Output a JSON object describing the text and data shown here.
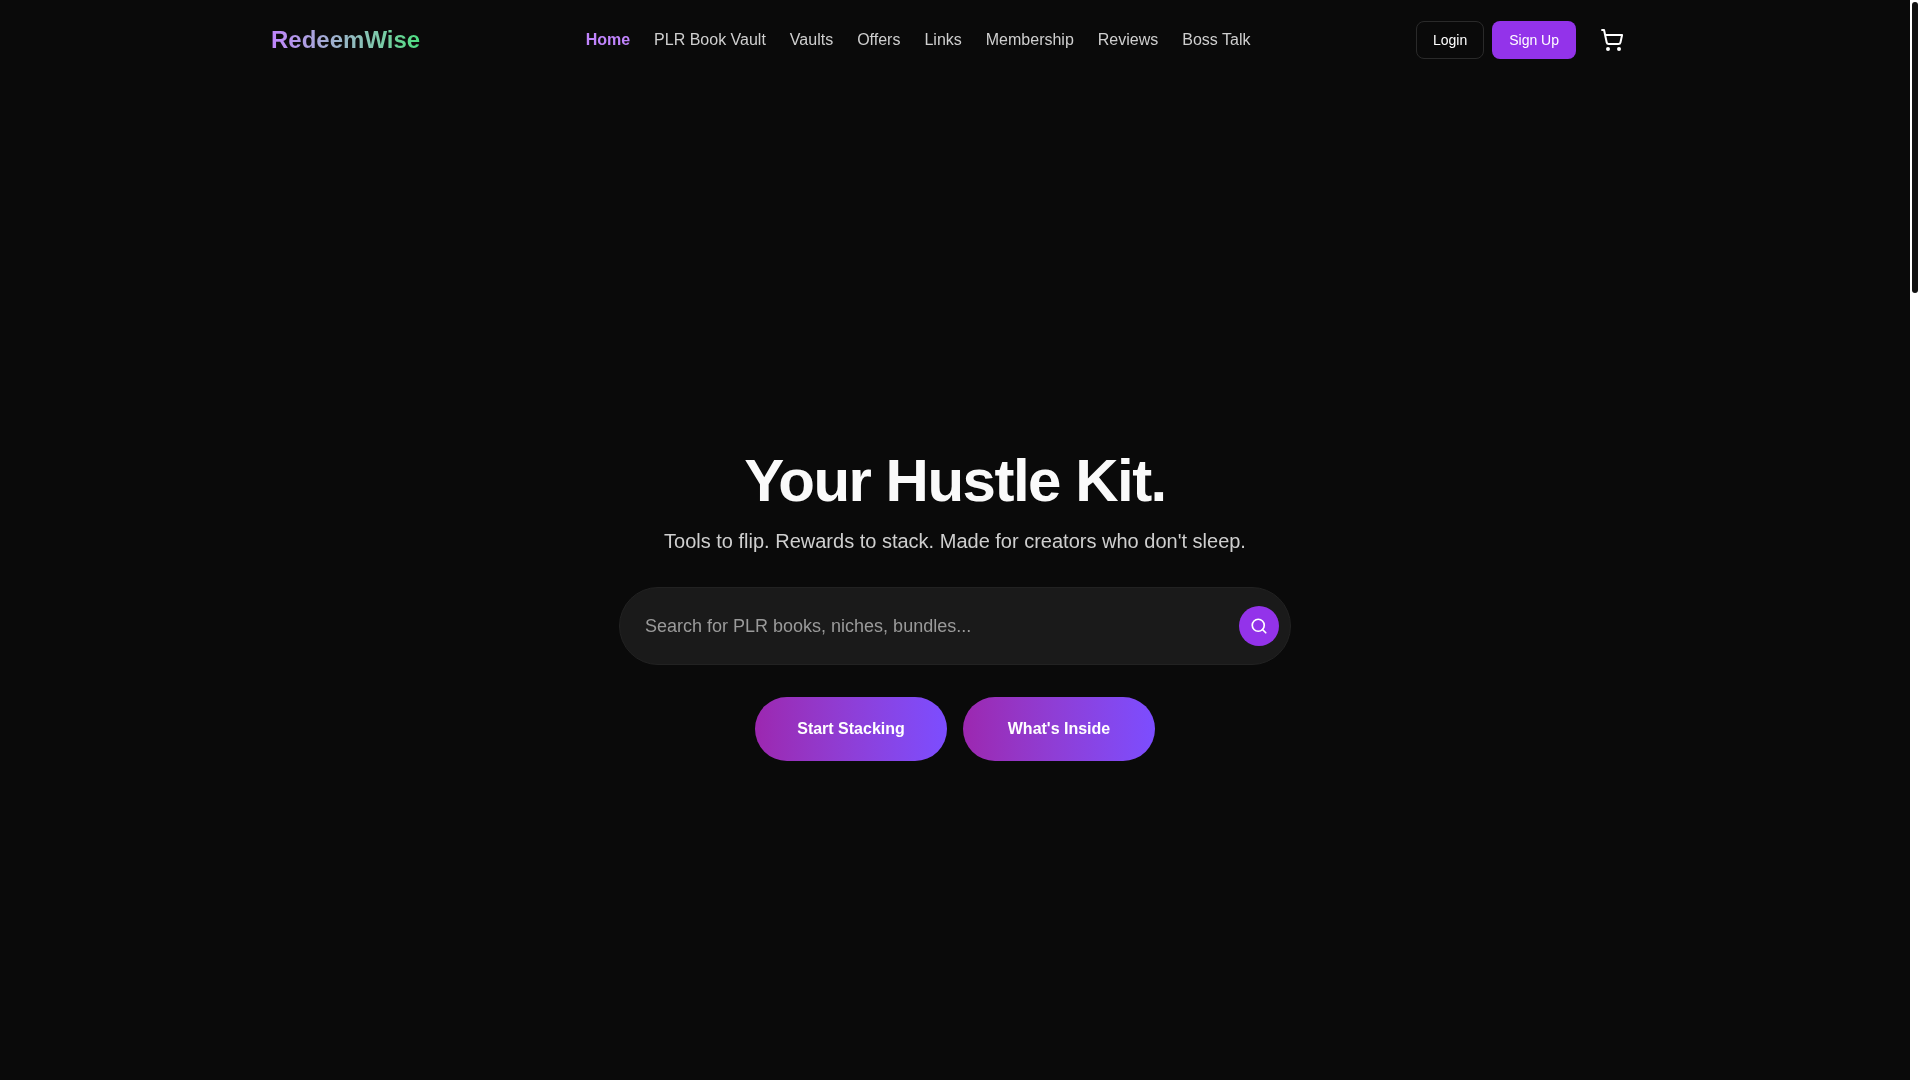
{
  "header": {
    "logo": "RedeemWise",
    "nav": [
      {
        "label": "Home",
        "selected": true
      },
      {
        "label": "PLR Book Vault",
        "selected": false
      },
      {
        "label": "Vaults",
        "selected": false
      },
      {
        "label": "Offers",
        "selected": false
      },
      {
        "label": "Links",
        "selected": false
      },
      {
        "label": "Membership",
        "selected": false
      },
      {
        "label": "Reviews",
        "selected": false
      },
      {
        "label": "Boss Talk",
        "selected": false
      }
    ],
    "actions": [
      {
        "label": "Login",
        "kind": "outline"
      },
      {
        "label": "Sign Up",
        "kind": "solid"
      }
    ]
  },
  "hero": {
    "title": "Your Hustle Kit.",
    "subtitle": "Tools to flip. Rewards to stack. Made for creators who don't sleep.",
    "search": {
      "placeholder": "Search for PLR books, niches, bundles..."
    },
    "buttons": [
      "Start Stacking",
      "What's Inside"
    ]
  }
}
